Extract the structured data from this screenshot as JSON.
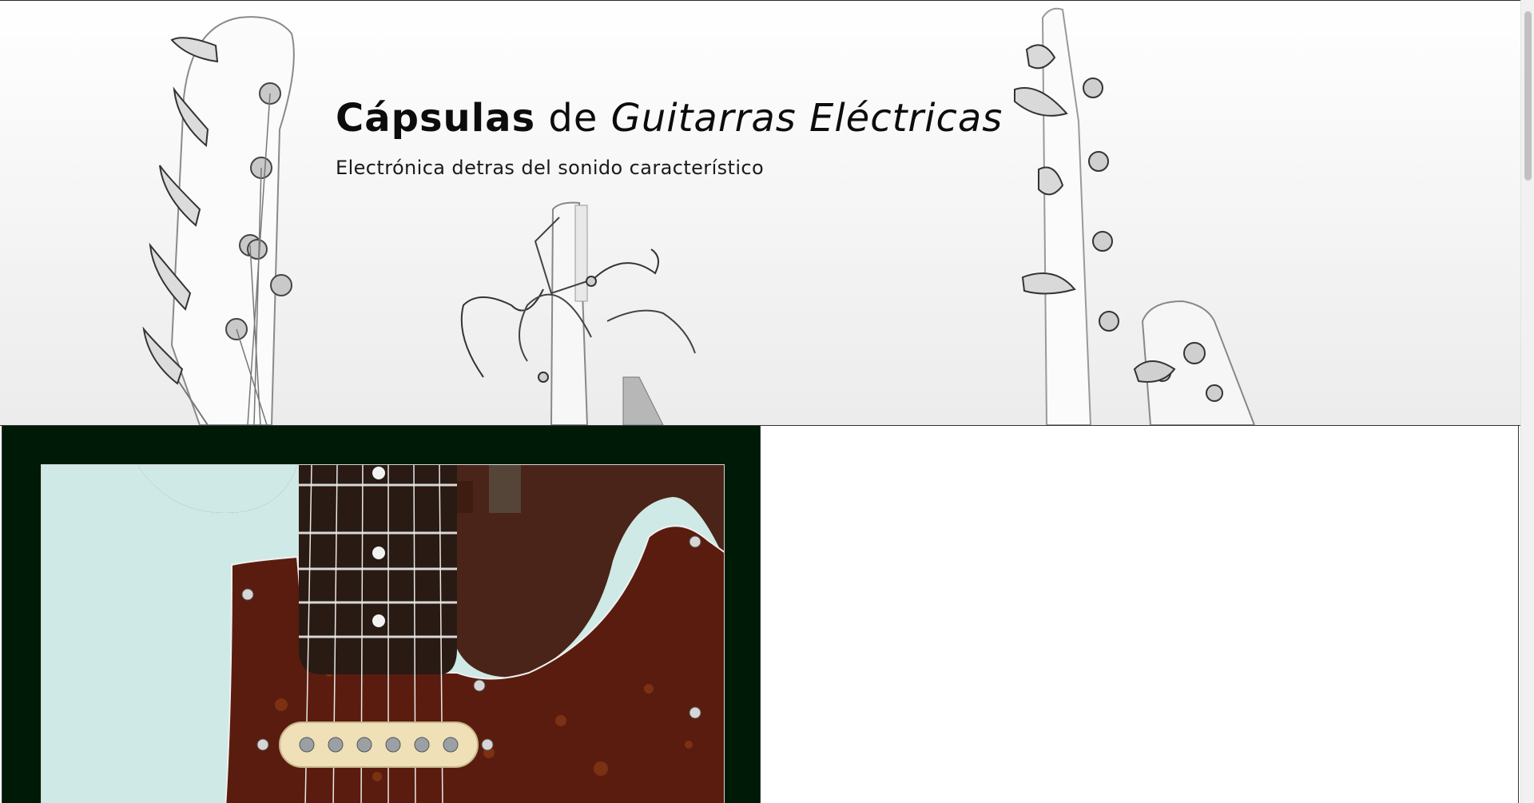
{
  "hero": {
    "title_part1": "Cápsulas",
    "title_part2": " de ",
    "title_part3": "Guitarras Eléctricas",
    "subtitle": "Electrónica detras del sonido característico"
  },
  "colors": {
    "left_panel_bg": "#001a08",
    "guitar_body": "#cfe9e6",
    "pickguard": "#5a1c0e",
    "fretboard": "#2a1a14",
    "pickup_cover": "#efe0b8"
  }
}
